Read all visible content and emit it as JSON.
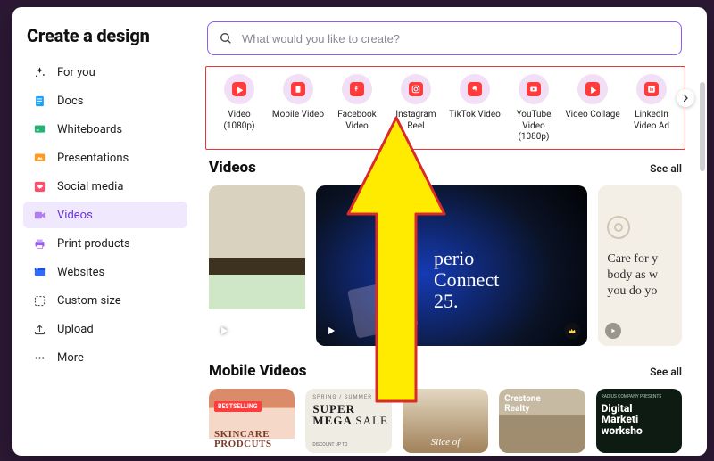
{
  "title": "Create a design",
  "search": {
    "placeholder": "What would you like to create?"
  },
  "sidebar": {
    "items": [
      {
        "label": "For you",
        "icon": "sparkles",
        "active": false
      },
      {
        "label": "Docs",
        "icon": "doc",
        "active": false
      },
      {
        "label": "Whiteboards",
        "icon": "whiteboard",
        "active": false
      },
      {
        "label": "Presentations",
        "icon": "present",
        "active": false
      },
      {
        "label": "Social media",
        "icon": "heart",
        "active": false
      },
      {
        "label": "Videos",
        "icon": "video",
        "active": true
      },
      {
        "label": "Print products",
        "icon": "print",
        "active": false
      },
      {
        "label": "Websites",
        "icon": "web",
        "active": false
      },
      {
        "label": "Custom size",
        "icon": "custom",
        "active": false
      },
      {
        "label": "Upload",
        "icon": "upload",
        "active": false
      },
      {
        "label": "More",
        "icon": "more",
        "active": false
      }
    ]
  },
  "categories": [
    {
      "label": "Video (1080p)"
    },
    {
      "label": "Mobile Video"
    },
    {
      "label": "Facebook Video"
    },
    {
      "label": "Instagram Reel"
    },
    {
      "label": "TikTok Video"
    },
    {
      "label": "YouTube Video (1080p)"
    },
    {
      "label": "Video Collage"
    },
    {
      "label": "LinkedIn Video Ad"
    }
  ],
  "sections": {
    "videos": {
      "title": "Videos",
      "see_all": "See all"
    },
    "mobile": {
      "title": "Mobile Videos",
      "see_all": "See all"
    }
  },
  "cards": {
    "hero_line1": "perio",
    "hero_line2": "Connect",
    "hero_line3": "25.",
    "care_line1": "Care for y",
    "care_line2": "body as w",
    "care_line3": "you do yo",
    "m1_badge": "BESTSELLING",
    "m1_big": "SKINCARE PRODCUTS",
    "m2_small": "SPRING / SUMMER",
    "m2_big1": "SUPER",
    "m2_big2": "MEGA",
    "m2_big3": "SALE",
    "m2_foot": "DISCOUNT UP TO",
    "m3_text": "Slice of",
    "m4_l1": "Crestone",
    "m4_l2": "Realty",
    "m5_small": "RADIUS COMPANY PRESENTS",
    "m5_l1": "Digital",
    "m5_l2": "Marketi",
    "m5_l3": "worksho"
  },
  "colors": {
    "accent": "#8e5cf2",
    "highlight_border": "#e43b36"
  }
}
